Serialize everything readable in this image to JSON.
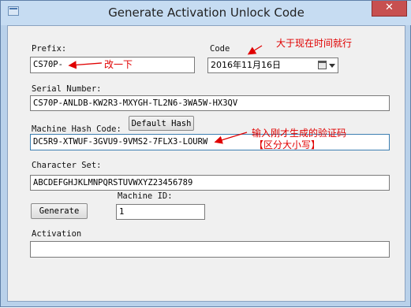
{
  "window": {
    "title": "Generate Activation Unlock Code",
    "close_glyph": "✕"
  },
  "fields": {
    "prefix": {
      "label": "Prefix:",
      "value": "CS70P-"
    },
    "code": {
      "label": "Code",
      "value": "2016年11月16日"
    },
    "serial": {
      "label": "Serial Number:",
      "value": "CS70P-ANLDB-KW2R3-MXYGH-TL2N6-3WA5W-HX3QV"
    },
    "machine_hash": {
      "label": "Machine Hash Code:",
      "value": "DC5R9-XTWUF-3GVU9-9VMS2-7FLX3-LOURW"
    },
    "charset": {
      "label": "Character Set:",
      "value": "ABCDEFGHJKLMNPQRSTUVWXYZ23456789"
    },
    "machine_id": {
      "label": "Machine ID:",
      "value": "1"
    },
    "activation": {
      "label": "Activation",
      "value": ""
    }
  },
  "buttons": {
    "default_hash": "Default Hash",
    "generate": "Generate"
  },
  "annotations": {
    "change_prefix": "改一下",
    "later_than_now": "大于现在时间就行",
    "enter_code_line1": "输入刚才生成的验证码",
    "enter_code_line2": "【区分大小写】"
  },
  "colors": {
    "annotation": "#e00000",
    "title_bar": "#c6dcf2",
    "close": "#c75050"
  },
  "icons": {
    "app": "app-icon",
    "calendar": "calendar-icon",
    "dropdown": "chevron-down-icon"
  }
}
